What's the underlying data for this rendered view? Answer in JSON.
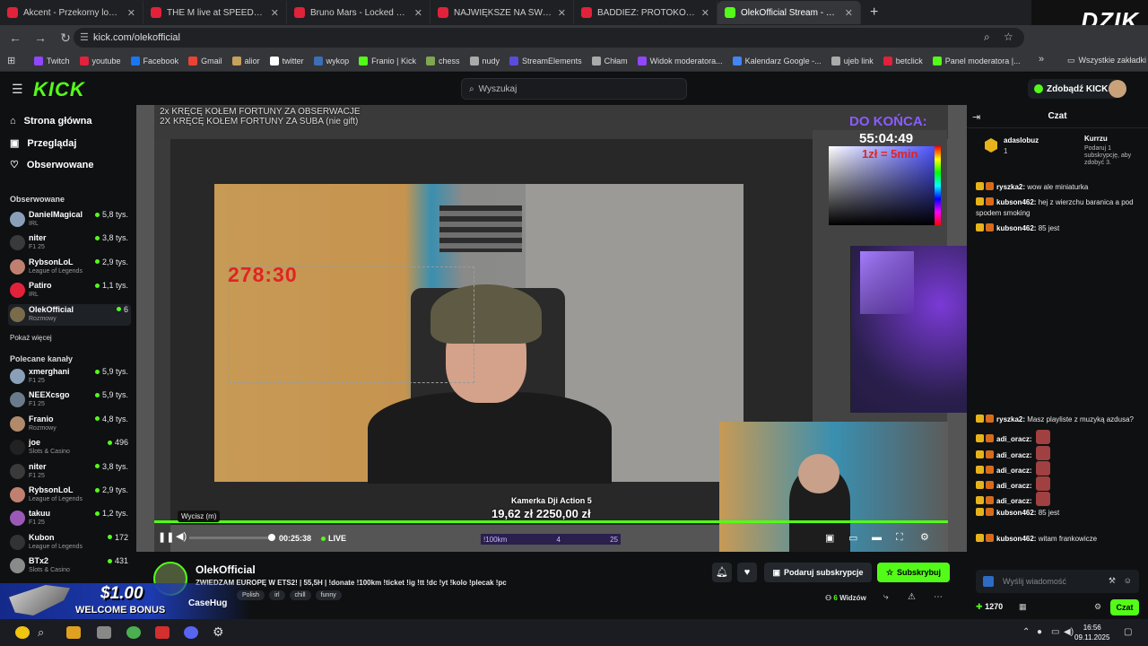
{
  "browser": {
    "tabs": [
      {
        "title": "Akcent - Przekorny los (Oficjalny",
        "color": "#e2213a"
      },
      {
        "title": "THE M live at SPEEDLAND FESTIVAL",
        "color": "#e2213a"
      },
      {
        "title": "Bruno Mars - Locked Out Of Heaven",
        "color": "#e2213a"
      },
      {
        "title": "NAJWIĘKSZE NA ŚWIECIE ZAWODY",
        "color": "#e2213a"
      },
      {
        "title": "BADDIEZ: PROTOKÓŁ BERLIN -",
        "color": "#e2213a"
      },
      {
        "title": "OlekOfficial Stream - Watch",
        "color": "#53fc18",
        "active": true
      }
    ],
    "new_tab": "+",
    "url": "kick.com/olekofficial",
    "bookmarks": [
      {
        "label": "Twitch",
        "color": "#9146ff"
      },
      {
        "label": "youtube",
        "color": "#e2213a"
      },
      {
        "label": "Facebook",
        "color": "#1877f2"
      },
      {
        "label": "Gmail",
        "color": "#ea4335"
      },
      {
        "label": "alior",
        "color": "#c6a15b"
      },
      {
        "label": "twitter",
        "color": "#ffffff"
      },
      {
        "label": "wykop",
        "color": "#3b6fb6"
      },
      {
        "label": "Franio | Kick",
        "color": "#53fc18"
      },
      {
        "label": "chess",
        "color": "#7fa650"
      },
      {
        "label": "nudy",
        "color": "#aaaaaa"
      },
      {
        "label": "StreamElements",
        "color": "#5a4cdb"
      },
      {
        "label": "Chłam",
        "color": "#aaaaaa"
      },
      {
        "label": "Widok moderatora...",
        "color": "#9146ff"
      },
      {
        "label": "Kalendarz Google -...",
        "color": "#4285f4"
      },
      {
        "label": "ujeb link",
        "color": "#aaaaaa"
      },
      {
        "label": "betclick",
        "color": "#e2213a"
      },
      {
        "label": "Panel moderatora |...",
        "color": "#53fc18"
      }
    ],
    "bookmarks_more": "»",
    "all_bookmarks": "Wszystkie zakładki"
  },
  "overlay_brand": "DZIK",
  "kick": {
    "logo": "KICK",
    "search_placeholder": "Wyszukaj",
    "get_kicks": "Zdobądź KICKs"
  },
  "sidebar": {
    "nav": [
      {
        "label": "Strona główna",
        "icon": "home-icon"
      },
      {
        "label": "Przeglądaj",
        "icon": "browse-icon"
      },
      {
        "label": "Obserwowane",
        "icon": "heart-icon"
      }
    ],
    "followed_title": "Obserwowane",
    "followed": [
      {
        "name": "DanielMagical",
        "cat": "IRL",
        "viewers": "5,8 tys.",
        "color": "#8aa0b8"
      },
      {
        "name": "niter",
        "cat": "F1 25",
        "viewers": "3,8 tys.",
        "color": "#3a3a3a"
      },
      {
        "name": "RybsonLoL",
        "cat": "League of Legends",
        "viewers": "2,9 tys.",
        "color": "#c08070"
      },
      {
        "name": "Patiro",
        "cat": "IRL",
        "viewers": "1,1 tys.",
        "color": "#e2213a"
      },
      {
        "name": "OlekOfficial",
        "cat": "Rozmowy",
        "viewers": "6",
        "color": "#7a6b4a",
        "selected": true
      }
    ],
    "show_more": "Pokaż więcej",
    "recommended_title": "Polecane kanały",
    "recommended": [
      {
        "name": "xmerghani",
        "cat": "F1 25",
        "viewers": "5,9 tys.",
        "color": "#8aa0b8"
      },
      {
        "name": "NEEXcsgo",
        "cat": "F1 25",
        "viewers": "5,9 tys.",
        "color": "#6b7a8a"
      },
      {
        "name": "Franio",
        "cat": "Rozmowy",
        "viewers": "4,8 tys.",
        "color": "#b08a6a"
      },
      {
        "name": "joe",
        "cat": "Slots & Casino",
        "viewers": "496",
        "color": "#222222"
      },
      {
        "name": "niter",
        "cat": "F1 25",
        "viewers": "3,8 tys.",
        "color": "#3a3a3a"
      },
      {
        "name": "RybsonLoL",
        "cat": "League of Legends",
        "viewers": "2,9 tys.",
        "color": "#c08070"
      },
      {
        "name": "takuu",
        "cat": "F1 25",
        "viewers": "1,2 tys.",
        "color": "#9b59b6"
      },
      {
        "name": "Kubon",
        "cat": "League of Legends",
        "viewers": "172",
        "color": "#333333"
      },
      {
        "name": "BTx2",
        "cat": "Slots & Casino",
        "viewers": "431",
        "color": "#8a8a8a"
      }
    ]
  },
  "video": {
    "overlay_line1": "2x KRĘCĘ KOŁEM FORTUNY ZA OBSERWACJE",
    "overlay_line2": "2X KRĘCĘ KOŁEM FORTUNY ZA SUBA (nie gift)",
    "do_konca": "DO KOŃCA:",
    "countdown": "55:04:49",
    "rate": "1zł = 5min",
    "red_timer": "278:30",
    "camera_label": "Kamerka Dji Action 5",
    "camera_money": "19,62 zł   2250,00 zł",
    "tooltip": "Wycisz (m)",
    "time": "00:25:38",
    "live": "LIVE",
    "km_label": "!100km",
    "km_value": "4",
    "km_total": "25",
    "progress_fraction": 0.15,
    "bar_progress_fraction": 1.0
  },
  "stream": {
    "name": "OlekOfficial",
    "title": "ZWIEDZAM EUROPĘ W ETS2! | 55,5H | !donate !100km !ticket !ig !tt !dc !yt !kolo !plecak !pc",
    "tags": [
      "Polish",
      "irl",
      "chill",
      "funny"
    ],
    "gift_button": "Podaruj subskrypcje",
    "sub_button": "Subskrybuj",
    "viewers_count": "6",
    "viewers_label": "Widzów"
  },
  "chat": {
    "title": "Czat",
    "pinned": {
      "user": "adaslobuz",
      "count": "1",
      "gifter": "Kurrzu",
      "gift_text": "Podaruj 1 subskrypcję, aby zdobyć 3."
    },
    "messages": [
      {
        "user": "ryszka2:",
        "text": "wow ale miniaturka"
      },
      {
        "user": "kubson462:",
        "text": "hej z wierzchu baranica a pod spodem smoking"
      },
      {
        "user": "kubson462:",
        "text": "85 jest"
      },
      {
        "user": "ryszka2:",
        "text": "Masz playliste z muzyką azdusa?"
      },
      {
        "user": "adi_oracz:",
        "text": ""
      },
      {
        "user": "adi_oracz:",
        "text": ""
      },
      {
        "user": "adi_oracz:",
        "text": ""
      },
      {
        "user": "adi_oracz:",
        "text": ""
      },
      {
        "user": "adi_oracz:",
        "text": ""
      },
      {
        "user": "kubson462:",
        "text": "85 jest"
      },
      {
        "user": "kubson462:",
        "text": "witam frankowicze"
      }
    ],
    "input_placeholder": "Wyślij wiadomość",
    "points": "1270",
    "send_button": "Czat"
  },
  "bonus": {
    "amount": "$1.00",
    "text": "WELCOME BONUS",
    "brand": "CaseHug"
  },
  "taskbar": {
    "time": "16:56",
    "date": "09.11.2025"
  }
}
